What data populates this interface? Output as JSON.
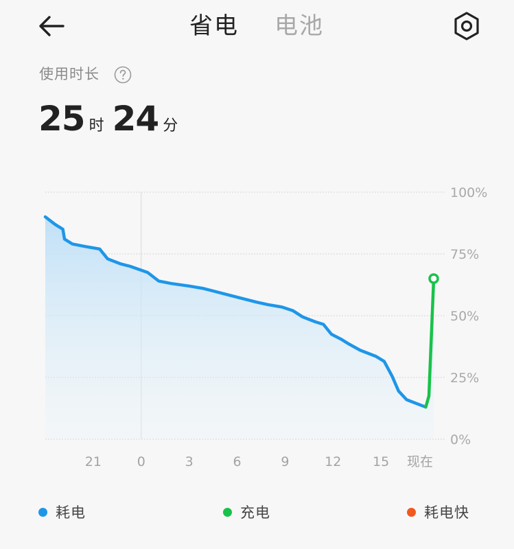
{
  "header": {
    "tabs": [
      {
        "label": "省电",
        "active": true
      },
      {
        "label": "电池",
        "active": false
      }
    ],
    "back_icon": "arrow-left-icon",
    "settings_icon": "settings-gear-icon"
  },
  "usage": {
    "label": "使用时长",
    "help_icon": "help-circle-icon",
    "hours": "25",
    "hours_unit": "时",
    "minutes": "24",
    "minutes_unit": "分"
  },
  "chart_data": {
    "type": "area",
    "title": "",
    "xlabel": "",
    "ylabel": "",
    "y_ticks": [
      "100%",
      "75%",
      "50%",
      "25%",
      "0%"
    ],
    "y_tick_values": [
      100,
      75,
      50,
      25,
      0
    ],
    "x_ticks": [
      "21",
      "0",
      "3",
      "6",
      "9",
      "12",
      "15",
      "现在"
    ],
    "x_tick_hours": [
      21,
      24,
      27,
      30,
      33,
      36,
      39,
      42
    ],
    "ylim": [
      0,
      100
    ],
    "grid": true,
    "divider_hour": 24,
    "series": [
      {
        "name": "耗电",
        "color": "#1e96e8",
        "points": [
          [
            18.0,
            90
          ],
          [
            18.6,
            87
          ],
          [
            19.1,
            85
          ],
          [
            19.2,
            81
          ],
          [
            19.7,
            79
          ],
          [
            20.5,
            78
          ],
          [
            21.4,
            77
          ],
          [
            21.9,
            73
          ],
          [
            22.7,
            71
          ],
          [
            23.3,
            70
          ],
          [
            24.4,
            67.5
          ],
          [
            25.1,
            64
          ],
          [
            25.9,
            63
          ],
          [
            27.0,
            62
          ],
          [
            27.9,
            61
          ],
          [
            28.5,
            60
          ],
          [
            29.4,
            58.5
          ],
          [
            30.3,
            57
          ],
          [
            31.2,
            55.5
          ],
          [
            31.9,
            54.5
          ],
          [
            32.8,
            53.5
          ],
          [
            33.5,
            52
          ],
          [
            34.1,
            49.5
          ],
          [
            34.9,
            47.5
          ],
          [
            35.4,
            46.5
          ],
          [
            35.9,
            42.5
          ],
          [
            36.5,
            40.5
          ],
          [
            37.0,
            38.5
          ],
          [
            37.7,
            36
          ],
          [
            38.7,
            33.5
          ],
          [
            39.2,
            31.5
          ],
          [
            39.7,
            25.5
          ],
          [
            40.1,
            19.5
          ],
          [
            40.6,
            16
          ],
          [
            41.0,
            15
          ],
          [
            41.8,
            13
          ]
        ]
      },
      {
        "name": "充电",
        "color": "#18c24a",
        "points": [
          [
            41.8,
            13
          ],
          [
            42.0,
            17.5
          ],
          [
            42.3,
            65
          ]
        ]
      }
    ]
  },
  "legend": [
    {
      "label": "耗电",
      "color": "#1e96e8"
    },
    {
      "label": "充电",
      "color": "#18c24a"
    },
    {
      "label": "耗电快",
      "color": "#f2571e"
    }
  ]
}
